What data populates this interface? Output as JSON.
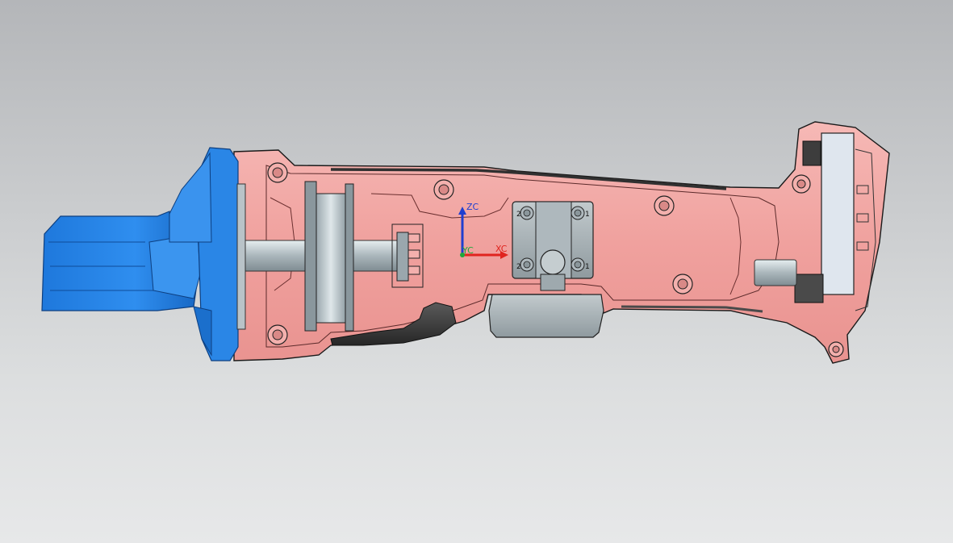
{
  "viewport": {
    "background_top": "#b4b6b9",
    "background_bottom": "#e7e8e9"
  },
  "colors": {
    "housing_fill": "#f2a7a4",
    "housing_edge": "#1a1a1a",
    "gearhead_fill": "#2b86e6",
    "gearhead_dark": "#1560b8",
    "metal_fill": "#c9d2d6",
    "bracket_fill": "#a9b3b8",
    "rubber_fill": "#3a3a3a",
    "battery_fill": "#d6dde8",
    "axis_z": "#1f3fd0",
    "axis_x": "#e0241f",
    "axis_y": "#1fa83a"
  },
  "csys": {
    "z_label": "ZC",
    "x_label": "XC",
    "y_label": "YC"
  },
  "bracket_labels": {
    "top_left": "2",
    "top_right": "1",
    "bottom_left": "2",
    "bottom_right": "1"
  }
}
